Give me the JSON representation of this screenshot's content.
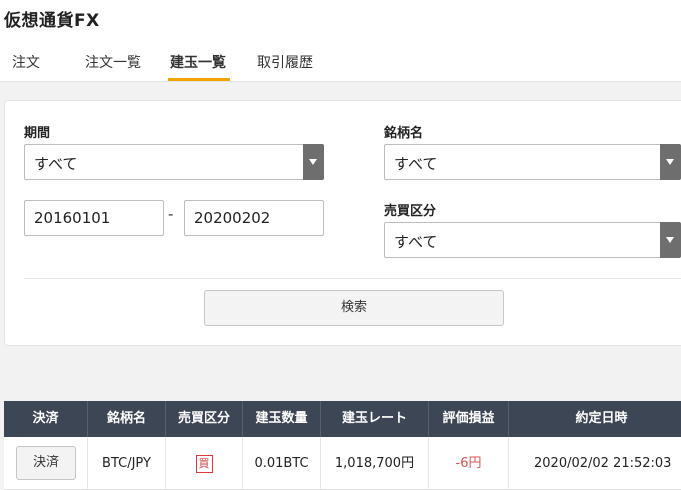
{
  "app": {
    "title": "仮想通貨FX"
  },
  "tabs": [
    {
      "label": "注文"
    },
    {
      "label": "注文一覧"
    },
    {
      "label": "建玉一覧"
    },
    {
      "label": "取引履歴"
    }
  ],
  "active_tab": "建玉一覧",
  "filters": {
    "period_label": "期間",
    "period_select": "すべて",
    "date_from": "20160101",
    "date_separator": "-",
    "date_to": "20200202",
    "symbol_label": "銘柄名",
    "symbol_select": "すべて",
    "side_label": "売買区分",
    "side_select": "すべて",
    "search_button": "検索"
  },
  "table": {
    "headers": [
      "決済",
      "銘柄名",
      "売買区分",
      "建玉数量",
      "建玉レート",
      "評価損益",
      "約定日時"
    ],
    "rows": [
      {
        "action": "決済",
        "symbol": "BTC/JPY",
        "side": "買",
        "quantity": "0.01BTC",
        "rate": "1,018,700円",
        "pnl": "-6円",
        "datetime": "2020/02/02 21:52:03"
      }
    ]
  },
  "colors": {
    "accent": "#f0a500",
    "header_bg": "#3c4654",
    "negative": "#e05252",
    "buy_badge": "#d93b3b"
  }
}
